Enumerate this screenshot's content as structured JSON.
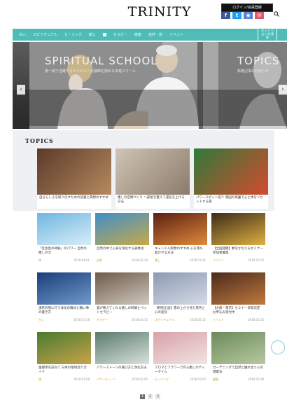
{
  "header": {
    "logo": "TRINITY",
    "login_label": "ログイン/会員登録",
    "social": [
      {
        "icon": "facebook-icon",
        "glyph": "f",
        "color": "#3b5998"
      },
      {
        "icon": "twitter-icon",
        "glyph": "t",
        "color": "#1da1f2"
      },
      {
        "icon": "rss-icon",
        "glyph": "◉",
        "color": "#5b7fd6"
      },
      {
        "icon": "mail-icon",
        "glyph": "✉",
        "color": "#e0596a"
      }
    ]
  },
  "nav": {
    "items": [
      "占い",
      "スピリチュアル",
      "ヒーリング",
      "癒し",
      "セラピー",
      "健康",
      "自然・旅",
      "イベント"
    ],
    "cta": "ネットで占いの通販"
  },
  "hero": {
    "title": "SPIRITUAL SCHOOL",
    "subtitle": "第一線で活躍するセラピストが講師を務める本格スクール",
    "title2": "TOPICS",
    "subtitle2": "新着記事のお知らせ"
  },
  "topics": {
    "title": "TOPICS",
    "cards": [
      {
        "caption": "自分らしさを取り戻すための読書と瞑想のすすめ",
        "colors": [
          "#5a3a2a",
          "#b68a5f"
        ]
      },
      {
        "caption": "癒しの空間づくり 〜部屋を整えて運気を上げる方法",
        "colors": [
          "#cfc4b6",
          "#8c7b6a"
        ]
      },
      {
        "caption": "パワースポット巡り 南国の楽園で心と体をリセットする旅",
        "colors": [
          "#2f7a3a",
          "#d44a2e"
        ]
      }
    ]
  },
  "grid": [
    {
      "caption": "「宮古島の神秘」のパワー 自然の癒しの力",
      "colors": [
        "#6fb5e0",
        "#d8eef8"
      ],
      "meta_left": "旅",
      "meta_right": "2018.04.01"
    },
    {
      "caption": "自然の中で心身を浄化する森林浴",
      "colors": [
        "#3e8fc9",
        "#c7a94a"
      ],
      "meta_left": "自然",
      "meta_right": "2018.03.28"
    },
    {
      "caption": "キャンドル瞑想のすすめ 心を落ち着かせる方法",
      "colors": [
        "#5a1e12",
        "#e08a3a"
      ],
      "meta_left": "癒し",
      "meta_right": "2018.03.25"
    },
    {
      "caption": "【全国開催】夢をかなえるセミナー参加者募集",
      "colors": [
        "#3a2a1a",
        "#e0b040"
      ],
      "meta_left": "イベント",
      "meta_right": "2018.03.20"
    },
    {
      "caption": "満月の夜に行う浄化の儀式と願い事の書き方",
      "colors": [
        "#1a3d7a",
        "#6f9acb"
      ],
      "meta_left": "占い",
      "meta_right": "2018.03.18"
    },
    {
      "caption": "猫が教えてくれる癒しの時間とペットセラピー",
      "colors": [
        "#6e5a46",
        "#cfc8c0"
      ],
      "meta_left": "セラピー",
      "meta_right": "2018.03.15"
    },
    {
      "caption": "【特別企画】雲の上から見た景色と心の変化",
      "colors": [
        "#8a9ab2",
        "#d6dbe6"
      ],
      "meta_left": "スピリチュアル",
      "meta_right": "2018.03.12"
    },
    {
      "caption": "【大阪・東京】セミナー日程決定 お申込み受付中",
      "colors": [
        "#4a2a1a",
        "#c07a40"
      ],
      "meta_left": "イベント",
      "meta_right": "2018.03.10"
    },
    {
      "caption": "金閣寺を訪ねて 日本の聖地巡りガイド",
      "colors": [
        "#4a7a30",
        "#c7a44a"
      ],
      "meta_left": "旅",
      "meta_right": "2018.03.08"
    },
    {
      "caption": "パワーストーンの選び方と浄化方法",
      "colors": [
        "#5a7a6a",
        "#d9e2dc"
      ],
      "meta_left": "パワーストーン",
      "meta_right": "2018.03.05"
    },
    {
      "caption": "アロマとフラワーで作る癒しのティータイム",
      "colors": [
        "#d8a0a8",
        "#f2e4e2"
      ],
      "meta_left": "ヒーリング",
      "meta_right": "2018.03.02"
    },
    {
      "caption": "ガーデニングで自然と触れ合う心の健康法",
      "colors": [
        "#6a8a5a",
        "#b8c8a0"
      ],
      "meta_left": "健康",
      "meta_right": "2018.02.28"
    }
  ],
  "pagination": {
    "pages": [
      "1",
      "2",
      "3"
    ],
    "current": "1"
  }
}
